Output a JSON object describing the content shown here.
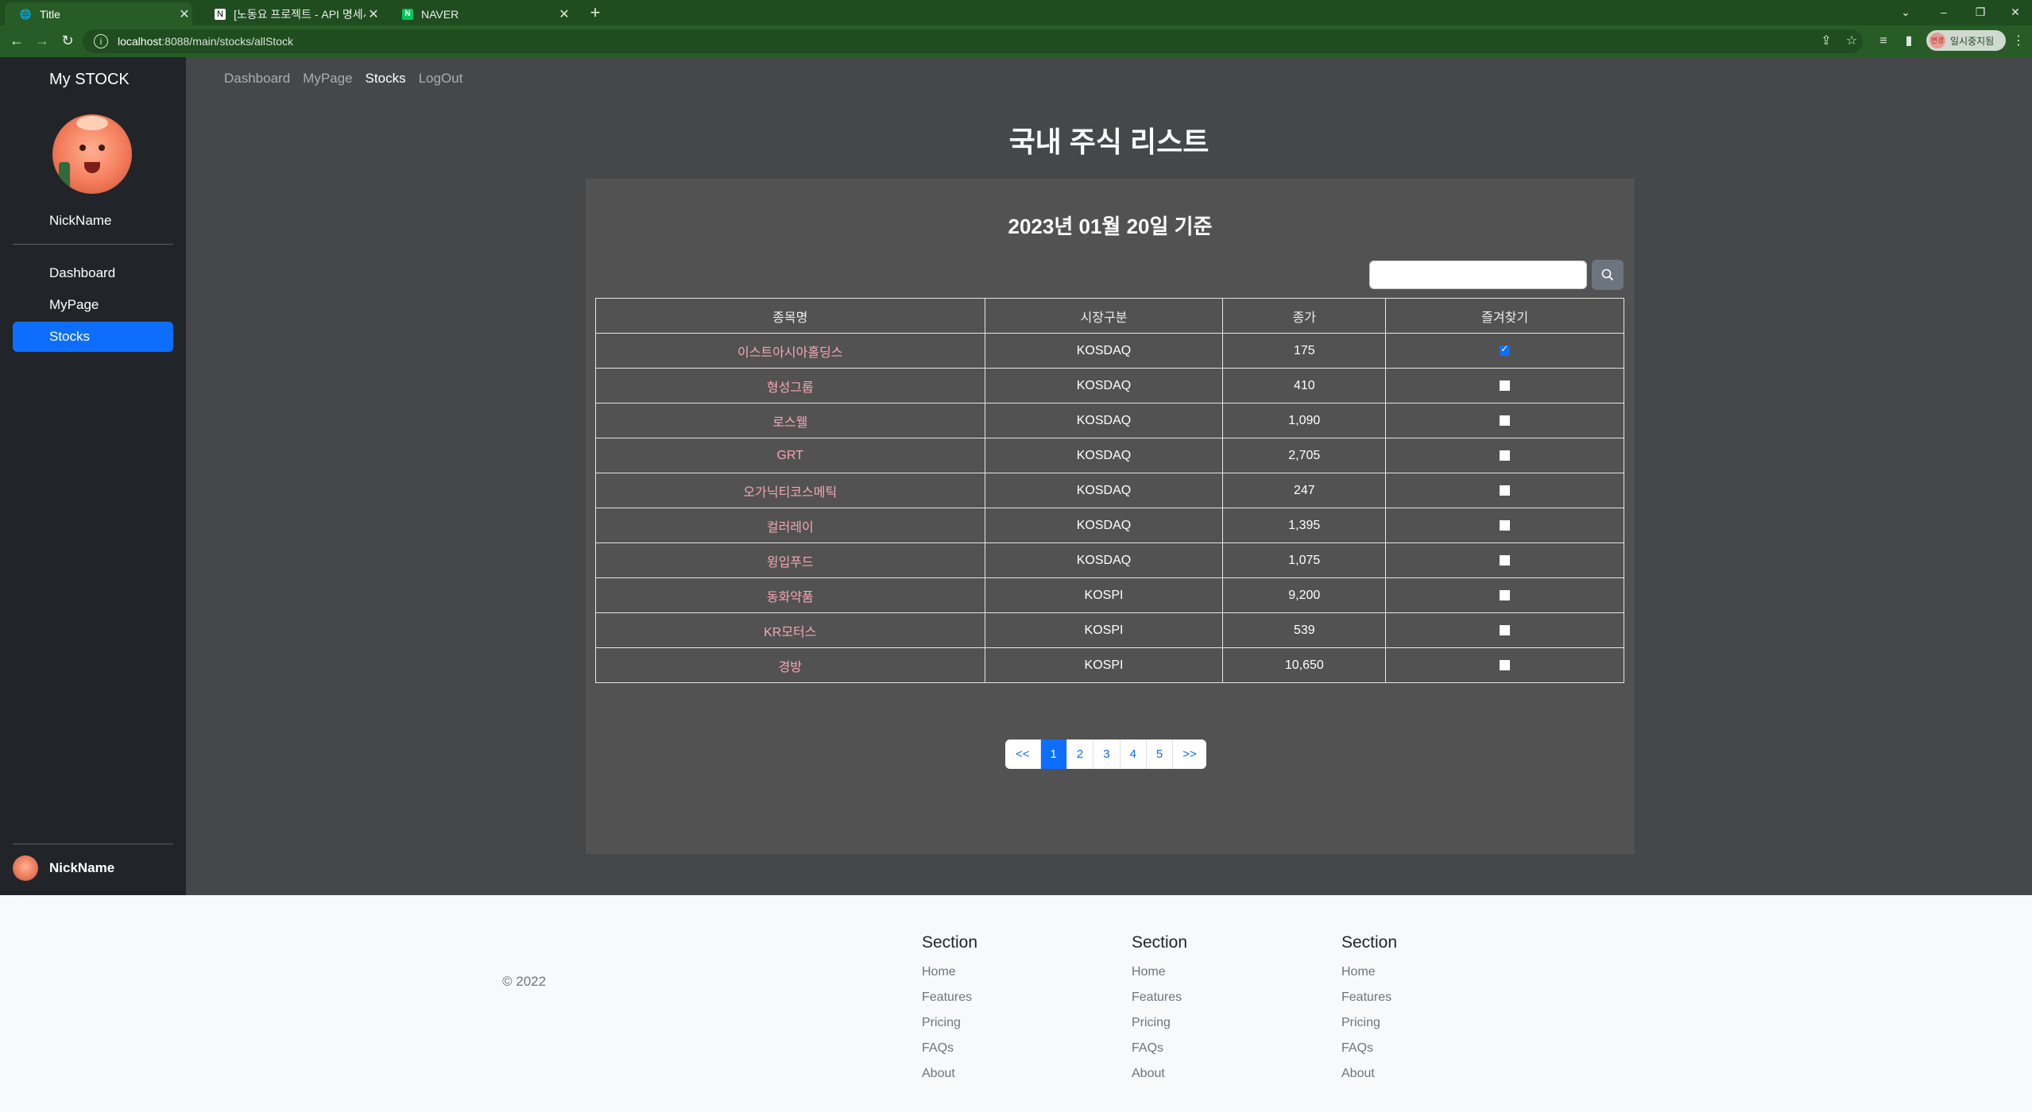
{
  "browser": {
    "tabs": [
      {
        "title": "Title",
        "active": true,
        "icon": "globe-icon"
      },
      {
        "title": "[노동요 프로젝트 - API 명세서]",
        "active": false,
        "icon": "notion-icon"
      },
      {
        "title": "NAVER",
        "active": false,
        "icon": "naver-icon"
      }
    ],
    "url_host": "localhost",
    "url_rest": ":8088/main/stocks/allStock",
    "profile_label": "일시중지됨",
    "profile_badge": "변경"
  },
  "app": {
    "brand": "My STOCK",
    "topnav": [
      {
        "label": "Dashboard",
        "current": false
      },
      {
        "label": "MyPage",
        "current": false
      },
      {
        "label": "Stocks",
        "current": true
      },
      {
        "label": "LogOut",
        "current": false
      }
    ],
    "nickname": "NickName",
    "sidebar": [
      {
        "label": "Dashboard",
        "active": false
      },
      {
        "label": "MyPage",
        "active": false
      },
      {
        "label": "Stocks",
        "active": true
      }
    ],
    "footer_user": "NickName"
  },
  "page": {
    "title": "국내 주식 리스트",
    "date_heading": "2023년 01월 20일 기준",
    "search_placeholder": "",
    "columns": [
      "종목명",
      "시장구분",
      "종가",
      "즐겨찾기"
    ],
    "rows": [
      {
        "name": "이스트아시아홀딩스",
        "market": "KOSDAQ",
        "price": "175",
        "favorite": true
      },
      {
        "name": "형성그룹",
        "market": "KOSDAQ",
        "price": "410",
        "favorite": false
      },
      {
        "name": "로스웰",
        "market": "KOSDAQ",
        "price": "1,090",
        "favorite": false
      },
      {
        "name": "GRT",
        "market": "KOSDAQ",
        "price": "2,705",
        "favorite": false
      },
      {
        "name": "오가닉티코스메틱",
        "market": "KOSDAQ",
        "price": "247",
        "favorite": false
      },
      {
        "name": "컬러레이",
        "market": "KOSDAQ",
        "price": "1,395",
        "favorite": false
      },
      {
        "name": "윙입푸드",
        "market": "KOSDAQ",
        "price": "1,075",
        "favorite": false
      },
      {
        "name": "동화약품",
        "market": "KOSPI",
        "price": "9,200",
        "favorite": false
      },
      {
        "name": "KR모터스",
        "market": "KOSPI",
        "price": "539",
        "favorite": false
      },
      {
        "name": "경방",
        "market": "KOSPI",
        "price": "10,650",
        "favorite": false
      }
    ],
    "pagination": [
      "<<",
      "1",
      "2",
      "3",
      "4",
      "5",
      ">>"
    ],
    "current_page": "1"
  },
  "footer": {
    "copyright": "© 2022",
    "sections": [
      {
        "title": "Section",
        "links": [
          "Home",
          "Features",
          "Pricing",
          "FAQs",
          "About"
        ]
      },
      {
        "title": "Section",
        "links": [
          "Home",
          "Features",
          "Pricing",
          "FAQs",
          "About"
        ]
      },
      {
        "title": "Section",
        "links": [
          "Home",
          "Features",
          "Pricing",
          "FAQs",
          "About"
        ]
      }
    ]
  },
  "colors": {
    "accent": "#0d6efd",
    "sidebar_bg": "#212529",
    "main_bg": "#454749",
    "panel_bg": "#525252",
    "stock_name": "#f4a6b7",
    "browser_frame": "#275c27"
  }
}
